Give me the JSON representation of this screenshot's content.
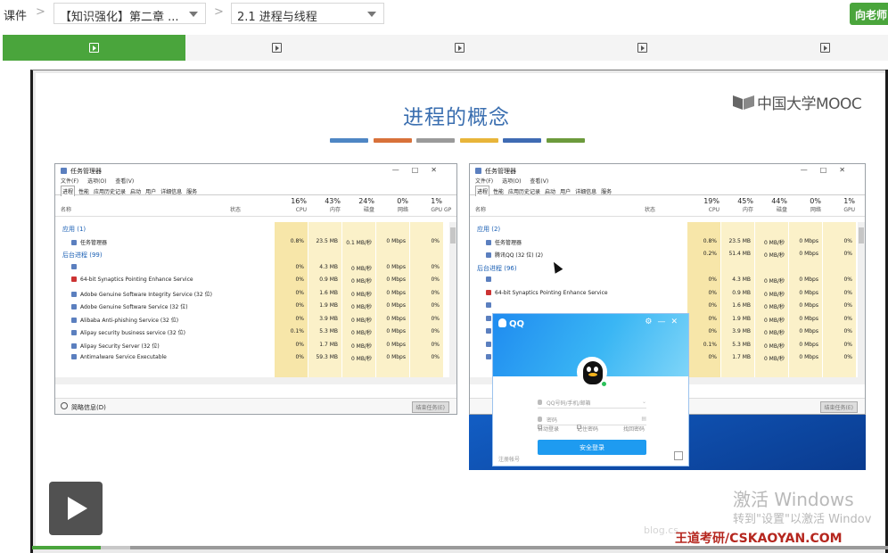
{
  "breadcrumb": {
    "root": "课件",
    "chapter_select": "【知识强化】第二章 ...",
    "section_select": "2.1 进程与线程"
  },
  "ask_button": "向老师",
  "tabs": [
    {
      "active": true
    },
    {
      "active": false
    },
    {
      "active": false
    },
    {
      "active": false
    },
    {
      "active": false
    }
  ],
  "progress": {
    "played_fraction": 0.08,
    "buffered_fraction": 0.115
  },
  "colors": {
    "accent_green": "#4aa53c",
    "title_blue": "#3b6fb0",
    "watermark_red": "#b5261e"
  },
  "slide": {
    "title": "进程的概念",
    "logo_text": "中国大学MOOC",
    "color_strips": [
      "#4e86c4",
      "#d8713a",
      "#9a9a9a",
      "#e8b53a",
      "#3f6bb3",
      "#6c9a3c"
    ]
  },
  "task_manager_left": {
    "title": "任务管理器",
    "menus": [
      "文件(F)",
      "选项(O)",
      "查看(V)"
    ],
    "tabs": [
      "进程",
      "性能",
      "应用历史记录",
      "启动",
      "用户",
      "详细信息",
      "服务"
    ],
    "col_name": "名称",
    "col_status": "状态",
    "metrics": [
      {
        "pct": "16%",
        "label": "CPU"
      },
      {
        "pct": "43%",
        "label": "内存"
      },
      {
        "pct": "24%",
        "label": "磁盘"
      },
      {
        "pct": "0%",
        "label": "网络"
      },
      {
        "pct": "1%",
        "label": "GPU"
      }
    ],
    "gp_label": "GP",
    "rows": [
      {
        "type": "group",
        "name": "应用 (1)"
      },
      {
        "type": "proc",
        "name": "任务管理器",
        "vals": [
          "0.8%",
          "23.5 MB",
          "0.1 MB/秒",
          "0 Mbps",
          "0%"
        ]
      },
      {
        "type": "group",
        "name": "后台进程 (99)"
      },
      {
        "type": "proc",
        "name": "",
        "vals": [
          "0%",
          "4.3 MB",
          "0 MB/秒",
          "0 Mbps",
          "0%"
        ]
      },
      {
        "type": "proc",
        "name": "64-bit Synaptics Pointing Enhance Service",
        "vals": [
          "0%",
          "0.9 MB",
          "0 MB/秒",
          "0 Mbps",
          "0%"
        ]
      },
      {
        "type": "proc",
        "name": "Adobe Genuine Software Integrity Service (32 位)",
        "vals": [
          "0%",
          "1.6 MB",
          "0 MB/秒",
          "0 Mbps",
          "0%"
        ]
      },
      {
        "type": "proc",
        "name": "Adobe Genuine Software Service (32 位)",
        "vals": [
          "0%",
          "1.9 MB",
          "0 MB/秒",
          "0 Mbps",
          "0%"
        ]
      },
      {
        "type": "proc",
        "name": "Alibaba Anti-phishing Service (32 位)",
        "vals": [
          "0%",
          "3.9 MB",
          "0 MB/秒",
          "0 Mbps",
          "0%"
        ]
      },
      {
        "type": "proc",
        "name": "Alipay security business service (32 位)",
        "vals": [
          "0.1%",
          "5.3 MB",
          "0 MB/秒",
          "0 Mbps",
          "0%"
        ]
      },
      {
        "type": "proc",
        "name": "Alipay Security Server (32 位)",
        "vals": [
          "0%",
          "1.7 MB",
          "0 MB/秒",
          "0 Mbps",
          "0%"
        ]
      },
      {
        "type": "proc",
        "name": "Antimalware Service Executable",
        "vals": [
          "0%",
          "59.3 MB",
          "0 MB/秒",
          "0 Mbps",
          "0%"
        ]
      }
    ],
    "footer_label": "简略信息(D)",
    "end_task": "结束任务(E)"
  },
  "task_manager_right": {
    "title": "任务管理器",
    "menus": [
      "文件(F)",
      "选项(O)",
      "查看(V)"
    ],
    "tabs": [
      "进程",
      "性能",
      "应用历史记录",
      "启动",
      "用户",
      "详细信息",
      "服务"
    ],
    "col_name": "名称",
    "col_status": "状态",
    "metrics": [
      {
        "pct": "19%",
        "label": "CPU"
      },
      {
        "pct": "45%",
        "label": "内存"
      },
      {
        "pct": "44%",
        "label": "磁盘"
      },
      {
        "pct": "0%",
        "label": "网络"
      },
      {
        "pct": "1%",
        "label": "GPU"
      }
    ],
    "rows": [
      {
        "type": "group",
        "name": "应用 (2)"
      },
      {
        "type": "proc",
        "name": "任务管理器",
        "vals": [
          "0.8%",
          "23.5 MB",
          "0 MB/秒",
          "0 Mbps",
          "0%"
        ]
      },
      {
        "type": "proc",
        "name": "腾讯QQ (32 位) (2)",
        "vals": [
          "0.2%",
          "51.4 MB",
          "0 MB/秒",
          "0 Mbps",
          "0%"
        ]
      },
      {
        "type": "group",
        "name": "后台进程 (96)"
      },
      {
        "type": "proc",
        "name": "",
        "vals": [
          "0%",
          "4.3 MB",
          "0 MB/秒",
          "0 Mbps",
          "0%"
        ]
      },
      {
        "type": "proc",
        "name": "64-bit Synaptics Pointing Enhance Service",
        "vals": [
          "0%",
          "0.9 MB",
          "0 MB/秒",
          "0 Mbps",
          "0%"
        ]
      },
      {
        "type": "proc",
        "name": "",
        "vals": [
          "0%",
          "1.6 MB",
          "0 MB/秒",
          "0 Mbps",
          "0%"
        ]
      },
      {
        "type": "proc",
        "name": "",
        "vals": [
          "0%",
          "1.9 MB",
          "0 MB/秒",
          "0 Mbps",
          "0%"
        ]
      },
      {
        "type": "proc",
        "name": "",
        "vals": [
          "0%",
          "3.9 MB",
          "0 MB/秒",
          "0 Mbps",
          "0%"
        ]
      },
      {
        "type": "proc",
        "name": "",
        "vals": [
          "0.1%",
          "5.3 MB",
          "0 MB/秒",
          "0 Mbps",
          "0%"
        ]
      },
      {
        "type": "proc",
        "name": "",
        "vals": [
          "0%",
          "1.7 MB",
          "0 MB/秒",
          "0 Mbps",
          "0%"
        ]
      }
    ],
    "end_task": "结束任务(E)"
  },
  "qq": {
    "brand": "QQ",
    "account_placeholder": "QQ号码/手机/邮箱",
    "password_placeholder": "密码",
    "auto_login": "自动登录",
    "remember_password": "记住密码",
    "recover_password": "找回密码",
    "login_button": "安全登录",
    "register": "注册帐号"
  },
  "overlay": {
    "activate_title": "激活 Windows",
    "activate_hint": "转到\"设置\"以激活 Windov",
    "watermark": "王道考研/CSKAOYAN.COM",
    "watermark_faint": "blog.cs"
  }
}
